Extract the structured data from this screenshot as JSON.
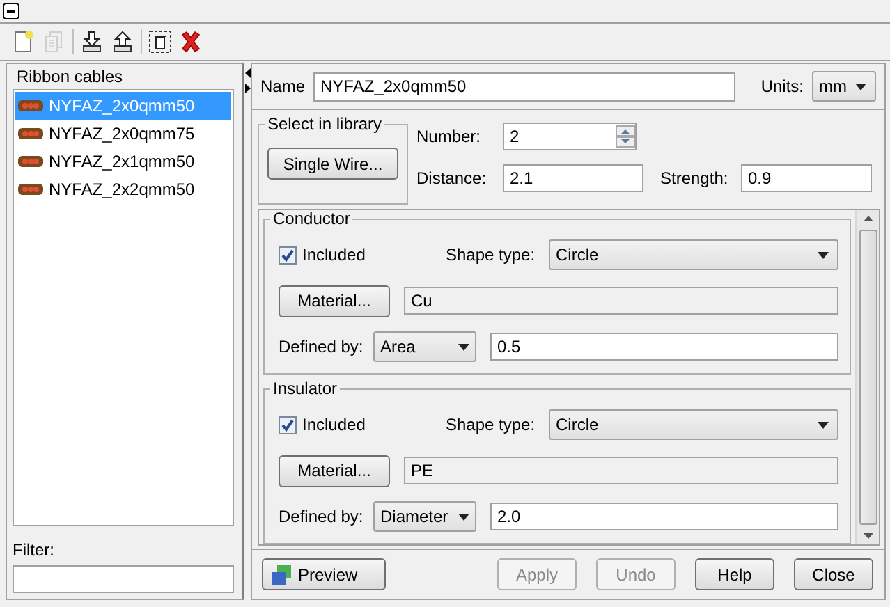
{
  "toolbar": [
    [
      {
        "kind": "new",
        "disabled": false
      },
      {
        "kind": "copy",
        "disabled": true
      }
    ],
    [
      {
        "kind": "import",
        "disabled": false
      },
      {
        "kind": "export",
        "disabled": false
      }
    ],
    [
      {
        "kind": "trash",
        "disabled": false
      },
      {
        "kind": "remove",
        "disabled": false
      }
    ]
  ],
  "library_list": {
    "title": "Ribbon cables",
    "items": [
      {
        "name": "NYFAZ_2x0qmm50",
        "selected": true
      },
      {
        "name": "NYFAZ_2x0qmm75",
        "selected": false
      },
      {
        "name": "NYFAZ_2x1qmm50",
        "selected": false
      },
      {
        "name": "NYFAZ_2x2qmm50",
        "selected": false
      }
    ],
    "filter": {
      "label": "Filter:"
    }
  },
  "name": {
    "label": "Name",
    "value": "NYFAZ_2x0qmm50"
  },
  "units": {
    "label": "Units:",
    "value": "mm"
  },
  "library": {
    "legend": "Select in library",
    "button": "Single Wire..."
  },
  "number": {
    "label": "Number:",
    "value": "2"
  },
  "distance": {
    "label": "Distance:",
    "value": "2.1"
  },
  "strength": {
    "label": "Strength:",
    "value": "0.9"
  },
  "sections": [
    {
      "legend": "Conductor",
      "included": {
        "label": "Included",
        "checked": true
      },
      "shape_type": {
        "label": "Shape type:",
        "value": "Circle"
      },
      "material_button": "Material...",
      "material": "Cu",
      "defined_by": {
        "label": "Defined by:",
        "value": "Area"
      },
      "amount": "0.5"
    },
    {
      "legend": "Insulator",
      "included": {
        "label": "Included",
        "checked": true
      },
      "shape_type": {
        "label": "Shape type:",
        "value": "Circle"
      },
      "material_button": "Material...",
      "material": "PE",
      "defined_by": {
        "label": "Defined by:",
        "value": "Diameter"
      },
      "amount": "2.0"
    }
  ],
  "buttons": [
    {
      "label": "Preview",
      "kind": "preview",
      "disabled": false
    },
    {
      "label": "Apply",
      "kind": "plain",
      "disabled": true
    },
    {
      "label": "Undo",
      "kind": "plain",
      "disabled": true
    },
    {
      "label": "Help",
      "kind": "plain",
      "disabled": false
    },
    {
      "label": "Close",
      "kind": "plain",
      "disabled": false
    }
  ]
}
